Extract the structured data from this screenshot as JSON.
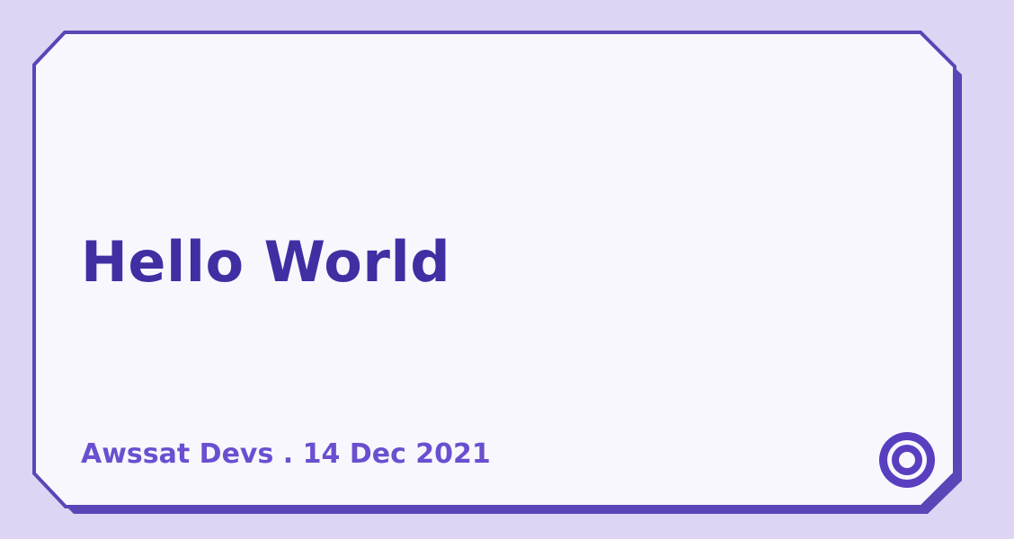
{
  "card": {
    "title": "Hello World",
    "meta": "Awssat Devs . 14 Dec 2021"
  },
  "colors": {
    "background": "#ded5f5",
    "card_fill": "#f8f7fd",
    "border": "#5a46b6",
    "title": "#3f2fa3",
    "meta": "#6a4fd0",
    "logo": "#5a3ec0"
  },
  "icons": {
    "logo": "ring-logo-icon"
  }
}
